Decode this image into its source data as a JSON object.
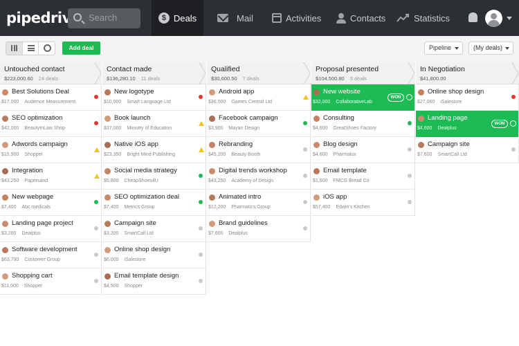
{
  "topbar": {
    "logo": "pipedrive",
    "search_placeholder": "Search",
    "nav": [
      {
        "label": "Deals",
        "icon": "deals-icon",
        "active": true
      },
      {
        "label": "Mail",
        "icon": "mail-icon"
      },
      {
        "label": "Activities",
        "icon": "calendar-icon"
      },
      {
        "label": "Contacts",
        "icon": "contacts-icon"
      },
      {
        "label": "Statistics",
        "icon": "statistics-icon"
      }
    ],
    "deals_icon_glyph": "$"
  },
  "toolbar": {
    "add_deal": "Add deal",
    "pipeline_select": "Pipeline",
    "filter_select": "(My deals)"
  },
  "colors": {
    "topbar": "#2c2f33",
    "accent_green": "#1dbb53",
    "status_red": "#e0372f",
    "status_yellow": "#f2c41b",
    "status_grey": "#c9c9c9"
  },
  "stages": [
    {
      "name": "Untouched contact",
      "value": "$223,000.60",
      "count": "24 deals",
      "deals": [
        {
          "title": "Best Solutions Deal",
          "value": "$17,000",
          "org": "Audience Measurement",
          "status": "red"
        },
        {
          "title": "SEO optimization",
          "value": "$42,000",
          "org": "BeautyInLaw Shop",
          "status": "red"
        },
        {
          "title": "Adwords campaign",
          "value": "$15,900",
          "org": "Shopper",
          "status": "yellow"
        },
        {
          "title": "Integration",
          "value": "$43,250",
          "org": "Papersand",
          "status": "yellow"
        },
        {
          "title": "New webpage",
          "value": "$7,400",
          "org": "Abc medicals",
          "status": "green"
        },
        {
          "title": "Landing page project",
          "value": "$3,200",
          "org": "Dealplus",
          "status": "grey"
        },
        {
          "title": "Software development",
          "value": "$63,700",
          "org": "Customer Group",
          "status": "grey"
        },
        {
          "title": "Shopping cart",
          "value": "$11,000",
          "org": "Shopper",
          "status": "grey"
        }
      ]
    },
    {
      "name": "Contact made",
      "value": "$136,280.10",
      "count": "11 deals",
      "deals": [
        {
          "title": "New logotype",
          "value": "$10,000",
          "org": "Smart Language Ltd",
          "status": "red"
        },
        {
          "title": "Book launch",
          "value": "$37,000",
          "org": "Ministry of Education",
          "status": "yellow"
        },
        {
          "title": "Native iOS app",
          "value": "$23,350",
          "org": "Bright Mind Publishing",
          "status": "yellow"
        },
        {
          "title": "Social media strategy",
          "value": "$5,800",
          "org": "CheapShoes4U",
          "status": "green"
        },
        {
          "title": "SEO optimization deal",
          "value": "$7,400",
          "org": "Metrics Group",
          "status": "green"
        },
        {
          "title": "Campaign site",
          "value": "$3,200",
          "org": "SmartCall Ltd",
          "status": "grey"
        },
        {
          "title": "Online shop design",
          "value": "$6,000",
          "org": "iSalestore",
          "status": "grey"
        },
        {
          "title": "Email template design",
          "value": "$4,500",
          "org": "Shopper",
          "status": "grey"
        }
      ]
    },
    {
      "name": "Qualified",
      "value": "$30,600.50",
      "count": "7 deals",
      "deals": [
        {
          "title": "Android app",
          "value": "$36,000",
          "org": "Games Central Ltd",
          "status": "yellow"
        },
        {
          "title": "Facebook campaign",
          "value": "$3,900",
          "org": "Mayan Design",
          "status": "green"
        },
        {
          "title": "Rebranding",
          "value": "$45,200",
          "org": "Beauty Booth",
          "status": "grey"
        },
        {
          "title": "Digital trends workshop",
          "value": "$43,250",
          "org": "Academy of Design",
          "status": "grey"
        },
        {
          "title": "Animated intro",
          "value": "$12,200",
          "org": "Pharmatics Group",
          "status": "grey"
        },
        {
          "title": "Brand guidelines",
          "value": "$7,600",
          "org": "Dealplus",
          "status": "grey"
        }
      ]
    },
    {
      "name": "Proposal presented",
      "value": "$104,500.80",
      "count": "5 deals",
      "deals": [
        {
          "title": "New website",
          "value": "$32,000",
          "org": "CollaborativeLab",
          "status": "won"
        },
        {
          "title": "Consulting",
          "value": "$4,600",
          "org": "GreatShoes Factory",
          "status": "green"
        },
        {
          "title": "Blog design",
          "value": "$4,600",
          "org": "Pharmalux",
          "status": "grey"
        },
        {
          "title": "Email template",
          "value": "$1,600",
          "org": "FMCG Bread Co",
          "status": "grey"
        },
        {
          "title": "iOS app",
          "value": "$57,400",
          "org": "Edwin's Kitchen",
          "status": "grey"
        }
      ]
    },
    {
      "name": "In Negotiation",
      "value": "$41,800.00",
      "count": "",
      "deals": [
        {
          "title": "Online shop design",
          "value": "$27,060",
          "org": "iSalestore",
          "status": "red"
        },
        {
          "title": "Landing page",
          "value": "$4,600",
          "org": "Dealplus",
          "status": "won"
        },
        {
          "title": "Campaign site",
          "value": "$7,600",
          "org": "SmartCall Ltd",
          "status": "grey"
        }
      ]
    }
  ],
  "won_label": "WON"
}
